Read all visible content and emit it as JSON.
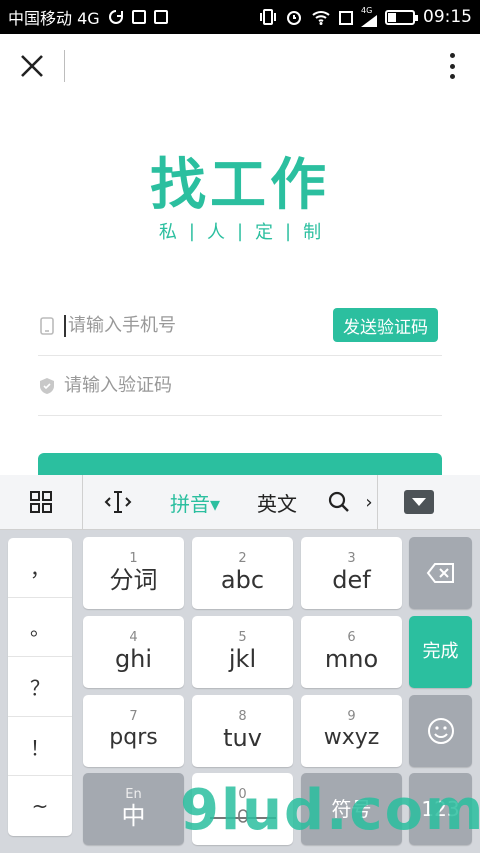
{
  "statusbar": {
    "carrier": "中国移动 4G",
    "network_badge": "4G",
    "time": "09:15",
    "battery_percent": 35
  },
  "appbar": {
    "close_icon": "close-icon",
    "more_icon": "more-vertical-icon"
  },
  "logo": {
    "title": "找工作",
    "subtitle": [
      "私",
      "人",
      "定",
      "制"
    ],
    "separator": "|"
  },
  "form": {
    "phone_placeholder": "请输入手机号",
    "send_code_label": "发送验证码",
    "code_placeholder": "请输入验证码"
  },
  "keyboard": {
    "toolbar": {
      "grid_icon": "grid-icon",
      "cursor_icon": "text-cursor-icon",
      "pinyin_label": "拼音▾",
      "english_label": "英文",
      "search_icon": "search-icon",
      "more_label": "›",
      "hide_icon": "keyboard-hide-icon"
    },
    "punctuation": [
      "，",
      "。",
      "？",
      "！",
      "~"
    ],
    "keys": [
      {
        "num": "1",
        "label": "分词"
      },
      {
        "num": "2",
        "label": "abc"
      },
      {
        "num": "3",
        "label": "def"
      },
      {
        "num": "4",
        "label": "ghi"
      },
      {
        "num": "5",
        "label": "jkl"
      },
      {
        "num": "6",
        "label": "mno"
      },
      {
        "num": "7",
        "label": "pqrs"
      },
      {
        "num": "8",
        "label": "tuv"
      },
      {
        "num": "9",
        "label": "wxyz"
      }
    ],
    "done_label": "完成",
    "emoji_icon": "smiley-icon",
    "backspace_icon": "backspace-icon",
    "lang_hint": "En",
    "lang_label": "中",
    "space_hint": "0",
    "symbol_label": "符号",
    "num_label": "123"
  },
  "watermark": {
    "text": "9lud.com"
  }
}
